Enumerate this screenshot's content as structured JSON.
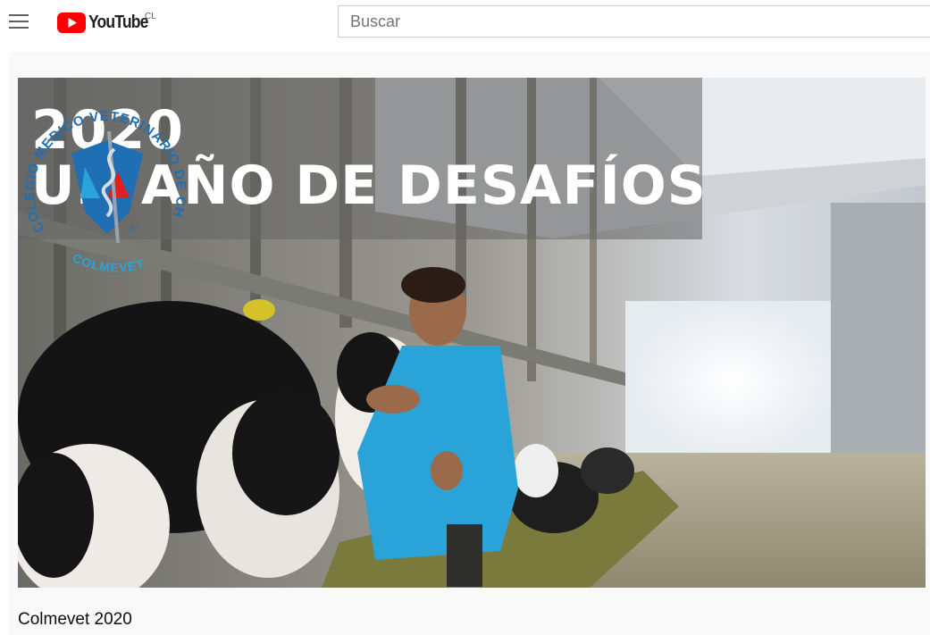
{
  "header": {
    "logo_text": "YouTube",
    "country_code": "CL",
    "search_placeholder": "Buscar"
  },
  "thumbnail": {
    "overlay_line1": "2020",
    "overlay_line2": "UN AÑO DE DESAFÍOS",
    "seal": {
      "arc_text_top": "COLEGIO MEDICO VETERINARIO DE CHILE A.G.",
      "arc_text_bottom": "COLMEVET",
      "registered_mark": "®"
    }
  },
  "video": {
    "title": "Colmevet 2020"
  },
  "colors": {
    "youtube_red": "#ff0000",
    "scrub_blue": "#2aa3d8",
    "seal_blue": "#1f6fb5",
    "seal_red": "#e02020"
  }
}
